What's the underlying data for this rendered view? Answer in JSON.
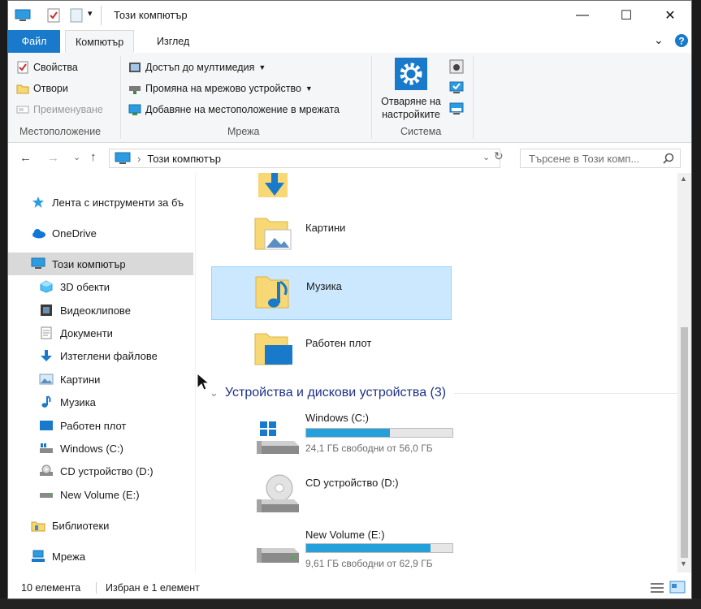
{
  "window": {
    "title": "Този компютър",
    "controls": {
      "minimize": "—",
      "maximize": "☐",
      "close": "✕"
    }
  },
  "ribbon": {
    "tabs": [
      {
        "label": "Файл"
      },
      {
        "label": "Компютър"
      },
      {
        "label": "Изглед"
      }
    ],
    "location_group": {
      "label": "Местоположение",
      "items": [
        {
          "label": "Свойства",
          "enabled": true
        },
        {
          "label": "Отвори",
          "enabled": true
        },
        {
          "label": "Преименуване",
          "enabled": false
        }
      ]
    },
    "network_group": {
      "label": "Мрежа",
      "items": [
        {
          "label": "Достъп до мултимедия"
        },
        {
          "label": "Промяна на мрежово устройство"
        },
        {
          "label": "Добавяне на местоположение в мрежата"
        }
      ]
    },
    "system_group": {
      "label": "Система",
      "open_settings_line1": "Отваряне на",
      "open_settings_line2": "настройките"
    }
  },
  "address": {
    "path": "Този компютър",
    "separator": "›",
    "search_placeholder": "Търсене в Този комп..."
  },
  "nav": {
    "items": [
      {
        "label": "Лента с инструменти за бъ",
        "icon": "star-icon"
      },
      {
        "label": "OneDrive",
        "icon": "cloud-icon"
      },
      {
        "label": "Този компютър",
        "icon": "computer-icon"
      },
      {
        "label": "3D обекти",
        "icon": "cube-icon"
      },
      {
        "label": "Видеоклипове",
        "icon": "film-icon"
      },
      {
        "label": "Документи",
        "icon": "document-icon"
      },
      {
        "label": "Изтеглени файлове",
        "icon": "download-icon"
      },
      {
        "label": "Картини",
        "icon": "picture-icon"
      },
      {
        "label": "Музика",
        "icon": "music-icon"
      },
      {
        "label": "Работен плот",
        "icon": "desktop-icon"
      },
      {
        "label": "Windows (C:)",
        "icon": "drive-icon"
      },
      {
        "label": "CD устройство (D:)",
        "icon": "cd-drive-icon"
      },
      {
        "label": "New Volume (E:)",
        "icon": "drive-icon"
      },
      {
        "label": "Библиотеки",
        "icon": "library-icon"
      },
      {
        "label": "Мрежа",
        "icon": "network-icon"
      }
    ]
  },
  "content": {
    "folders": [
      {
        "name": "Картини"
      },
      {
        "name": "Музика"
      },
      {
        "name": "Работен плот"
      }
    ],
    "devices_header": "Устройства и дискови устройства (3)",
    "drives": [
      {
        "name": "Windows (C:)",
        "free_text": "24,1 ГБ свободни от 56,0 ГБ",
        "used_fraction": 0.57
      },
      {
        "name": "CD устройство (D:)"
      },
      {
        "name": "New Volume (E:)",
        "free_text": "9,61 ГБ свободни от 62,9 ГБ",
        "used_fraction": 0.85
      }
    ]
  },
  "status": {
    "count": "10 елемента",
    "selection": "Избран е 1 елемент"
  },
  "colors": {
    "accent": "#1979ca",
    "selection": "#cce8ff",
    "drive_bar": "#26a0da",
    "folder": "#f8d775"
  }
}
